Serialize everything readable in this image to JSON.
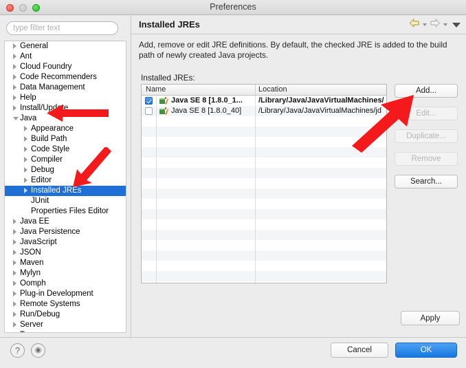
{
  "window": {
    "title": "Preferences",
    "traffic_lights": [
      "close",
      "minimize",
      "maximize"
    ]
  },
  "filter": {
    "placeholder": "type filter text",
    "value": ""
  },
  "tree": {
    "items": [
      {
        "label": "General",
        "level": 0,
        "expanded": false,
        "selected": false
      },
      {
        "label": "Ant",
        "level": 0,
        "expanded": false,
        "selected": false
      },
      {
        "label": "Cloud Foundry",
        "level": 0,
        "expanded": false,
        "selected": false
      },
      {
        "label": "Code Recommenders",
        "level": 0,
        "expanded": false,
        "selected": false
      },
      {
        "label": "Data Management",
        "level": 0,
        "expanded": false,
        "selected": false
      },
      {
        "label": "Help",
        "level": 0,
        "expanded": false,
        "selected": false
      },
      {
        "label": "Install/Update",
        "level": 0,
        "expanded": false,
        "selected": false
      },
      {
        "label": "Java",
        "level": 0,
        "expanded": true,
        "selected": false
      },
      {
        "label": "Appearance",
        "level": 1,
        "expanded": false,
        "selected": false
      },
      {
        "label": "Build Path",
        "level": 1,
        "expanded": false,
        "selected": false
      },
      {
        "label": "Code Style",
        "level": 1,
        "expanded": false,
        "selected": false
      },
      {
        "label": "Compiler",
        "level": 1,
        "expanded": false,
        "selected": false
      },
      {
        "label": "Debug",
        "level": 1,
        "expanded": false,
        "selected": false
      },
      {
        "label": "Editor",
        "level": 1,
        "expanded": false,
        "selected": false
      },
      {
        "label": "Installed JREs",
        "level": 1,
        "expanded": false,
        "selected": true
      },
      {
        "label": "JUnit",
        "level": 1,
        "expanded": false,
        "selected": false,
        "no_twisty": true
      },
      {
        "label": "Properties Files Editor",
        "level": 1,
        "expanded": false,
        "selected": false,
        "no_twisty": true
      },
      {
        "label": "Java EE",
        "level": 0,
        "expanded": false,
        "selected": false
      },
      {
        "label": "Java Persistence",
        "level": 0,
        "expanded": false,
        "selected": false
      },
      {
        "label": "JavaScript",
        "level": 0,
        "expanded": false,
        "selected": false
      },
      {
        "label": "JSON",
        "level": 0,
        "expanded": false,
        "selected": false
      },
      {
        "label": "Maven",
        "level": 0,
        "expanded": false,
        "selected": false
      },
      {
        "label": "Mylyn",
        "level": 0,
        "expanded": false,
        "selected": false
      },
      {
        "label": "Oomph",
        "level": 0,
        "expanded": false,
        "selected": false
      },
      {
        "label": "Plug-in Development",
        "level": 0,
        "expanded": false,
        "selected": false
      },
      {
        "label": "Remote Systems",
        "level": 0,
        "expanded": false,
        "selected": false
      },
      {
        "label": "Run/Debug",
        "level": 0,
        "expanded": false,
        "selected": false
      },
      {
        "label": "Server",
        "level": 0,
        "expanded": false,
        "selected": false
      },
      {
        "label": "Team",
        "level": 0,
        "expanded": false,
        "selected": false
      }
    ]
  },
  "page": {
    "title": "Installed JREs",
    "description": "Add, remove or edit JRE definitions. By default, the checked JRE is added to the build path of newly created Java projects.",
    "table_label": "Installed JREs:",
    "nav": {
      "back_icon": "back-arrow-icon",
      "forward_icon": "forward-arrow-icon",
      "menu_icon": "chevron-down-icon"
    }
  },
  "table": {
    "columns": [
      "Name",
      "Location"
    ],
    "rows": [
      {
        "checked": true,
        "bold": true,
        "name": "Java SE 8 [1.8.0_1...",
        "location": "/Library/Java/JavaVirtualMachines/"
      },
      {
        "checked": false,
        "bold": false,
        "name": "Java SE 8 [1.8.0_40]",
        "location": "/Library/Java/JavaVirtualMachines/jd"
      }
    ],
    "empty_row_count": 17
  },
  "buttons": {
    "add": {
      "label": "Add...",
      "enabled": true
    },
    "edit": {
      "label": "Edit...",
      "enabled": false
    },
    "duplicate": {
      "label": "Duplicate...",
      "enabled": false
    },
    "remove": {
      "label": "Remove",
      "enabled": false
    },
    "search": {
      "label": "Search...",
      "enabled": true
    },
    "apply": {
      "label": "Apply",
      "enabled": true
    },
    "cancel": {
      "label": "Cancel",
      "enabled": true
    },
    "ok": {
      "label": "OK",
      "enabled": true
    }
  },
  "bottom": {
    "help_icon": "question-mark-icon",
    "info_icon": "info-circle-icon"
  },
  "annotations": {
    "arrow_color": "#f4191a",
    "arrows": [
      {
        "name": "arrow-pointing-to-java-node",
        "direction": "left"
      },
      {
        "name": "arrow-pointing-to-installed-jres-node",
        "direction": "down-left"
      },
      {
        "name": "arrow-pointing-to-add-button",
        "direction": "up-right"
      }
    ]
  },
  "colors": {
    "selection_blue": "#1f6fd6",
    "ok_button_blue": "#1577e0",
    "annotation_red": "#f4191a",
    "window_background": "#ececec"
  }
}
